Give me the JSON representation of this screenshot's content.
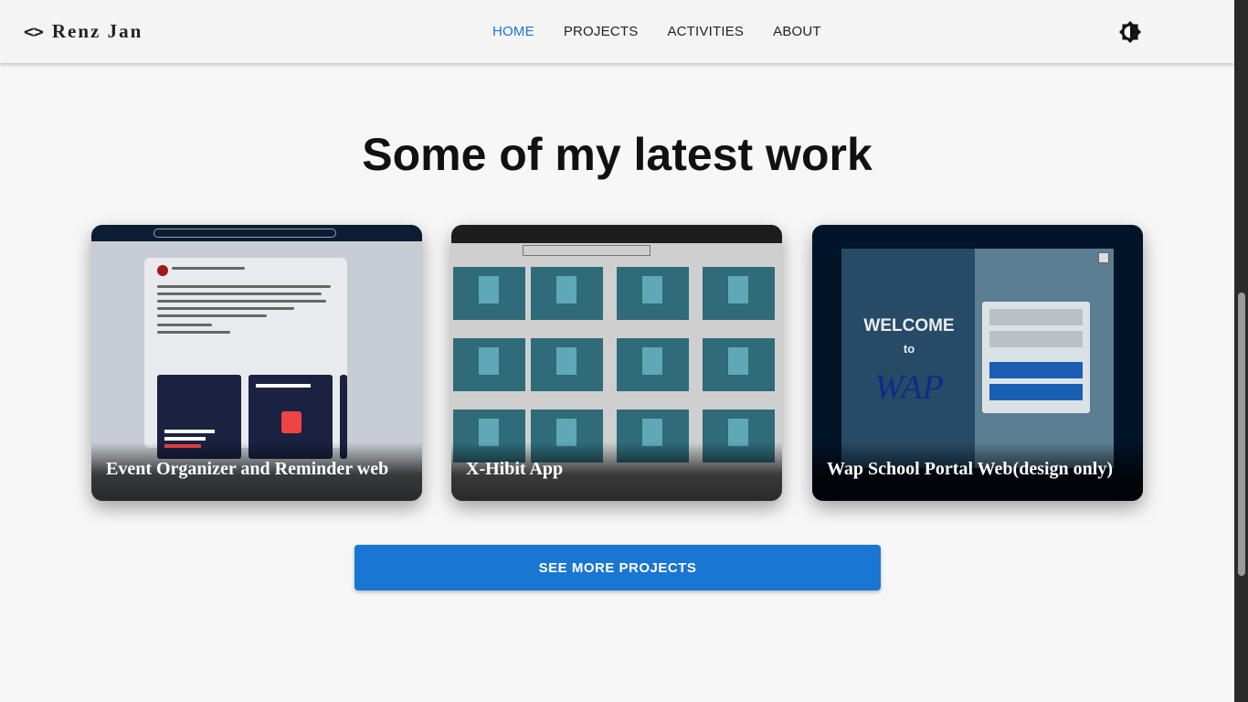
{
  "header": {
    "brand_icon": "<>",
    "brand_name": "Renz Jan",
    "nav": [
      "HOME",
      "PROJECTS",
      "ACTIVITIES",
      "ABOUT"
    ],
    "active_nav": "HOME",
    "theme_icon": "brightness-icon"
  },
  "section": {
    "heading": "Some of my latest work"
  },
  "cards": [
    {
      "title": "Event Organizer and Reminder web"
    },
    {
      "title": "X-Hibit App"
    },
    {
      "title": "Wap School Portal Web(design only)"
    }
  ],
  "card3_mock": {
    "welcome": "WELCOME",
    "to": "to",
    "wap": "WAP"
  },
  "see_more_label": "SEE MORE PROJECTS",
  "colors": {
    "accent": "#1976d2",
    "background": "#f7f7f7",
    "header": "#f4f4f4"
  }
}
